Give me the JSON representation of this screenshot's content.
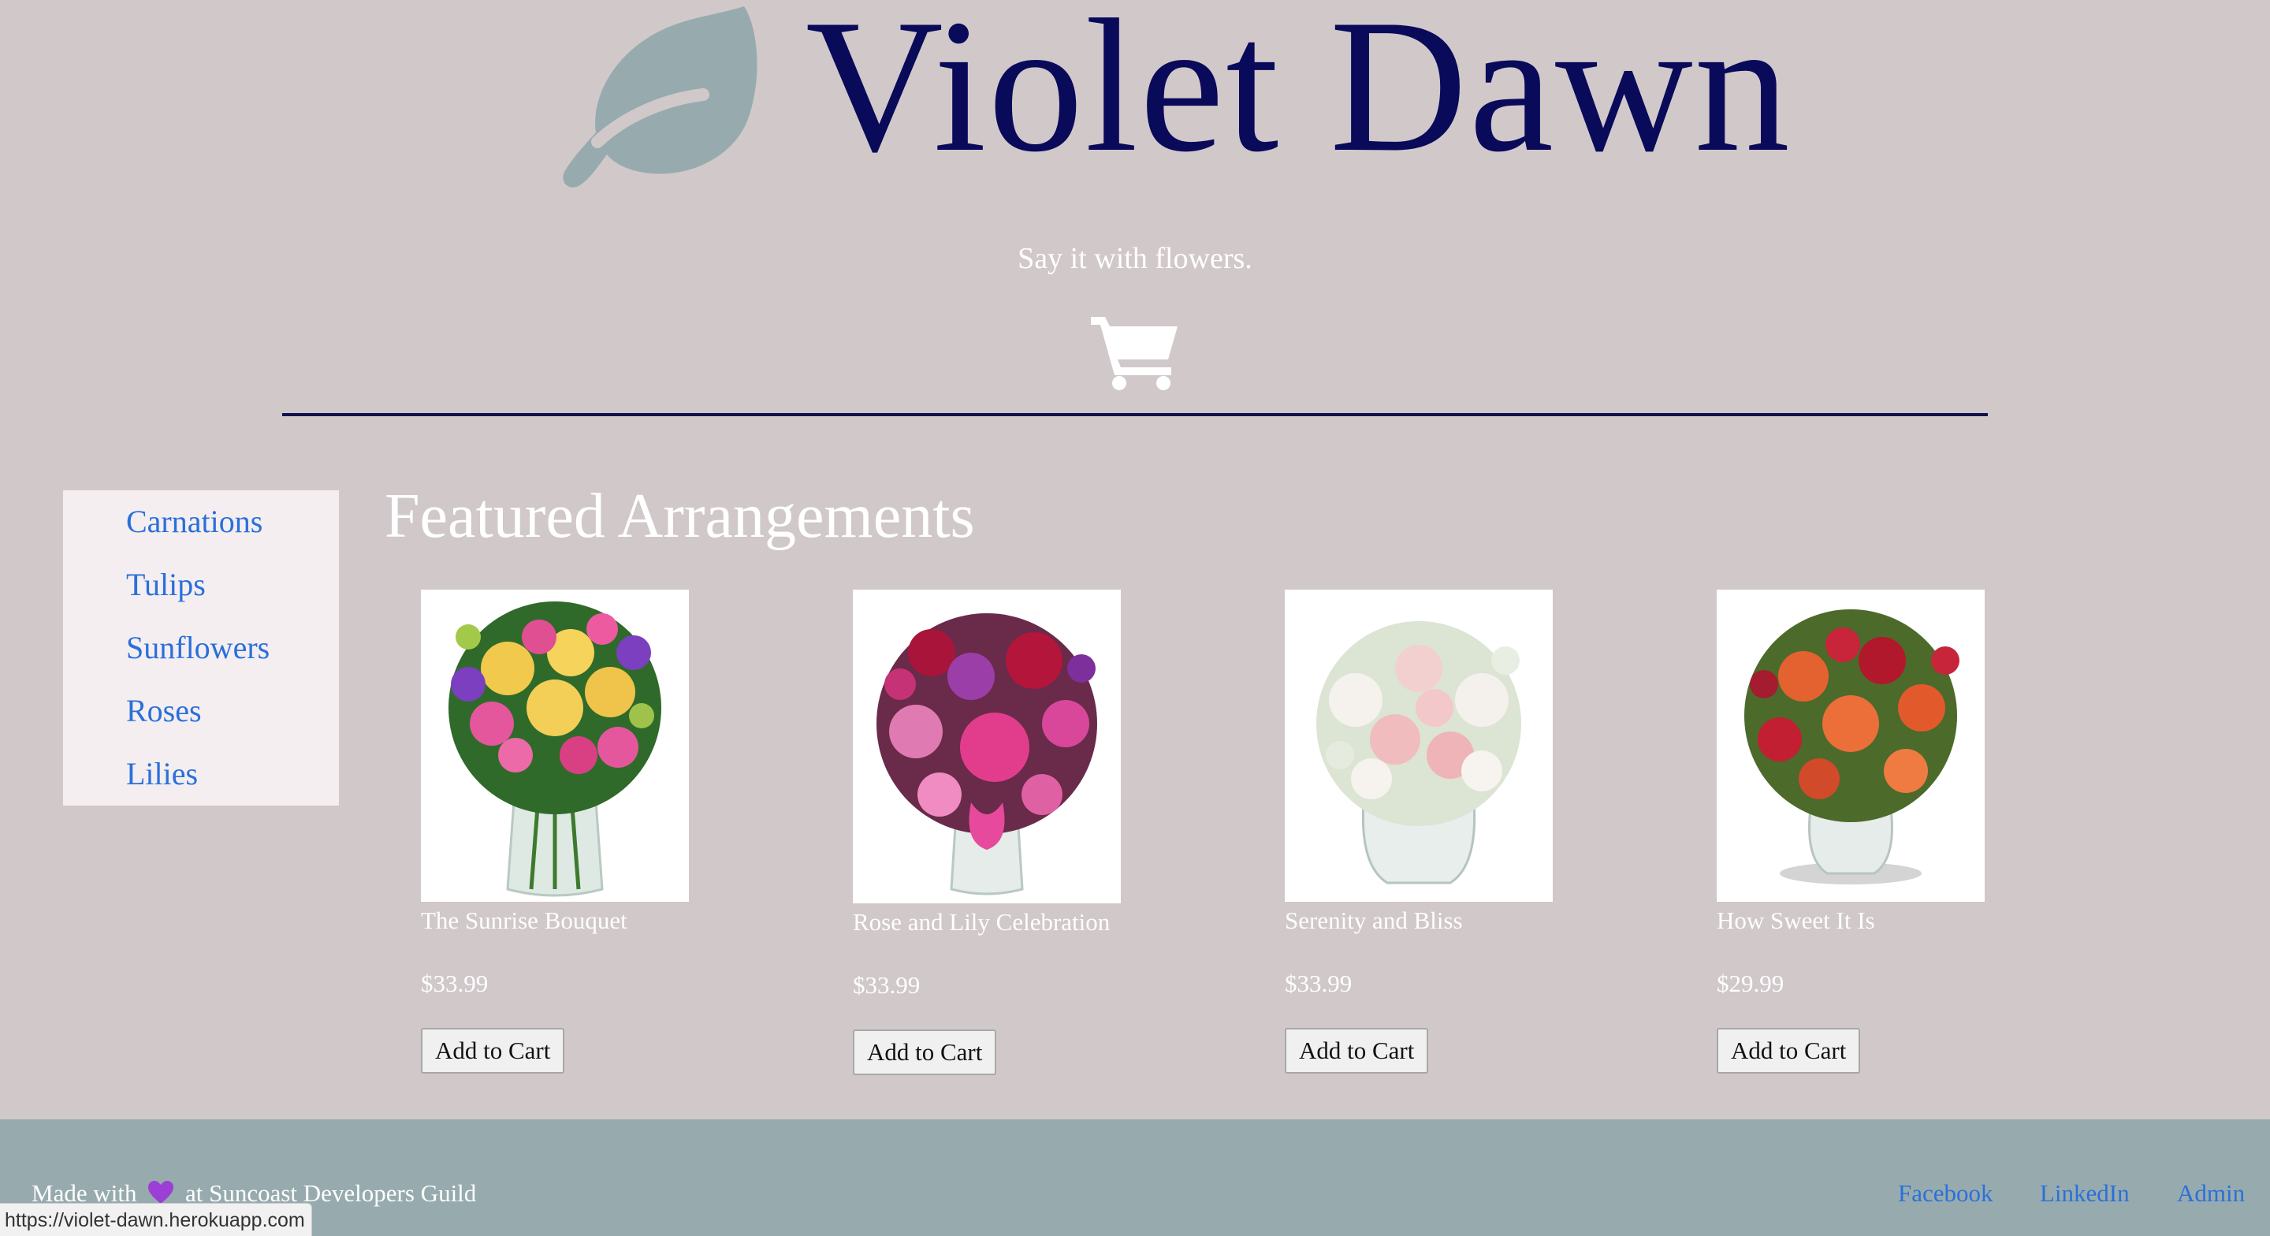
{
  "brand": {
    "title": "Violet Dawn",
    "tagline": "Say it with flowers.",
    "logo_icon": "leaf-icon",
    "cart_icon": "shopping-cart-icon"
  },
  "colors": {
    "background": "#d1c8ca",
    "title": "#0a0a5a",
    "leaf": "#97abae",
    "link": "#2a6fdb",
    "sidebar": "#f4eef0",
    "footer": "#97abae"
  },
  "sidebar": {
    "items": [
      {
        "label": "Carnations"
      },
      {
        "label": "Tulips"
      },
      {
        "label": "Sunflowers"
      },
      {
        "label": "Roses"
      },
      {
        "label": "Lilies"
      }
    ]
  },
  "main": {
    "title": "Featured Arrangements",
    "products": [
      {
        "name": "The Sunrise Bouquet",
        "price": "$33.99",
        "button": "Add to Cart"
      },
      {
        "name": "Rose and Lily Celebration",
        "price": "$33.99",
        "button": "Add to Cart"
      },
      {
        "name": "Serenity and Bliss",
        "price": "$33.99",
        "button": "Add to Cart"
      },
      {
        "name": "How Sweet It Is",
        "price": "$29.99",
        "button": "Add to Cart"
      }
    ]
  },
  "footer": {
    "credit_prefix": "Made with",
    "credit_icon": "purple-heart-icon",
    "credit_suffix": "at Suncoast Developers Guild",
    "links": [
      {
        "label": "Facebook"
      },
      {
        "label": "LinkedIn"
      },
      {
        "label": "Admin"
      }
    ]
  },
  "status_bar": {
    "url": "https://violet-dawn.herokuapp.com"
  }
}
